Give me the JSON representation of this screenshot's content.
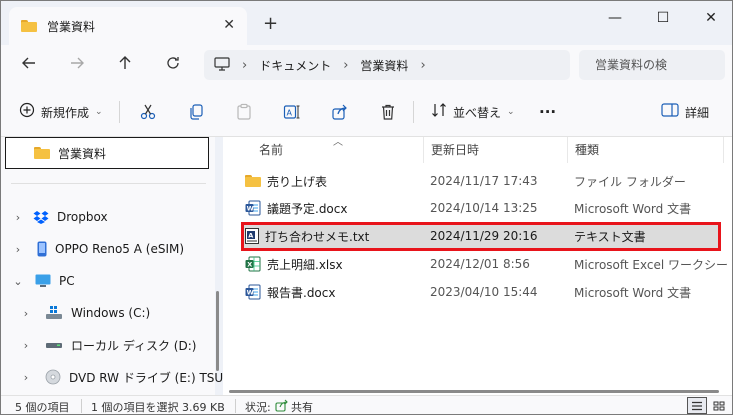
{
  "window": {
    "tab_title": "営業資料",
    "new_tab": "+",
    "close_tab": "✕",
    "minimize": "—",
    "maximize": "☐",
    "close": "✕"
  },
  "address": {
    "segments": [
      "ドキュメント",
      "営業資料"
    ],
    "search_placeholder": "営業資料の検"
  },
  "toolbar": {
    "new_label": "新規作成",
    "sort_label": "並べ替え",
    "more_label": "···",
    "details_label": "詳細"
  },
  "nav": {
    "selected": "営業資料",
    "items": [
      {
        "label": "Dropbox",
        "icon": "dropbox-icon"
      },
      {
        "label": "OPPO Reno5 A (eSIM)",
        "icon": "phone-icon"
      },
      {
        "label": "PC",
        "icon": "pc-icon"
      },
      {
        "label": "Windows (C:)",
        "icon": "windows-drive-icon"
      },
      {
        "label": "ローカル ディスク (D:)",
        "icon": "drive-icon"
      },
      {
        "label": "DVD RW ドライブ (E:) TSUYAK",
        "icon": "dvd-icon"
      }
    ]
  },
  "columns": {
    "name": "名前",
    "date": "更新日時",
    "type": "種類"
  },
  "files": [
    {
      "name": "売り上げ表",
      "date": "2024/11/17 17:43",
      "type": "ファイル フォルダー",
      "icon": "folder-icon"
    },
    {
      "name": "議題予定.docx",
      "date": "2024/10/14 13:25",
      "type": "Microsoft Word 文書",
      "icon": "word-icon"
    },
    {
      "name": "打ち合わせメモ.txt",
      "date": "2024/11/29 20:16",
      "type": "テキスト文書",
      "icon": "text-file-icon"
    },
    {
      "name": "売上明細.xlsx",
      "date": "2024/12/01 8:56",
      "type": "Microsoft Excel ワークシート",
      "icon": "excel-icon"
    },
    {
      "name": "報告書.docx",
      "date": "2023/04/10 15:44",
      "type": "Microsoft Word 文書",
      "icon": "word-icon"
    }
  ],
  "status": {
    "count": "5 個の項目",
    "selection": "1 個の項目を選択  3.69 KB",
    "state_label": "状況:",
    "state_value": "共有"
  },
  "colors": {
    "highlight": "#e8141b",
    "folder": "#f5c142",
    "word": "#2b579a",
    "excel": "#217346"
  }
}
